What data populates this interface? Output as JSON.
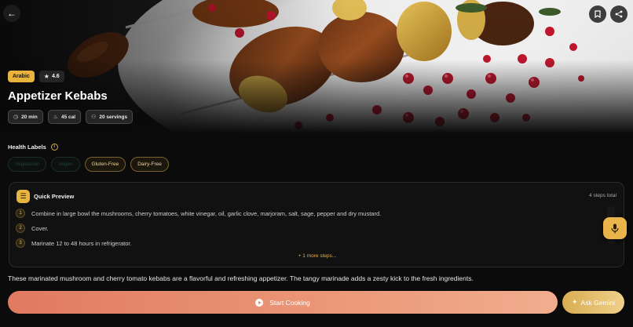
{
  "hero": {
    "cuisine": "Arabic",
    "rating": "4.6",
    "title": "Appetizer Kebabs",
    "meta": [
      {
        "icon": "clock-icon",
        "label": "20 min"
      },
      {
        "icon": "flame-icon",
        "label": "45 cal"
      },
      {
        "icon": "people-icon",
        "label": "20 servings"
      }
    ]
  },
  "health": {
    "title": "Health Labels",
    "chips": [
      {
        "label": "Vegetarian",
        "active": false
      },
      {
        "label": "Vegan",
        "active": false
      },
      {
        "label": "Gluten-Free",
        "active": true
      },
      {
        "label": "Dairy-Free",
        "active": true
      }
    ]
  },
  "preview": {
    "title": "Quick Preview",
    "count": "4 steps total",
    "steps": [
      {
        "num": "1",
        "text": "Combine in large bowl the mushrooms, cherry tomatoes, white vinegar, oil, garlic clove, marjoram, salt, sage, pepper and dry mustard."
      },
      {
        "num": "2",
        "text": "Cover."
      },
      {
        "num": "3",
        "text": "Marinate 12 to 48 hours in refrigerator."
      }
    ],
    "more": "+ 1 more steps..."
  },
  "description": "These marinated mushroom and cherry tomato kebabs are a flavorful and refreshing appetizer. The tangy marinade adds a zesty kick to the fresh ingredients.",
  "actions": {
    "start": "Start Cooking",
    "gemini": "Ask Gemini"
  },
  "colors": {
    "accent": "#e8b53e",
    "start_gradient_from": "#e07a60",
    "start_gradient_to": "#f0ad8e"
  }
}
